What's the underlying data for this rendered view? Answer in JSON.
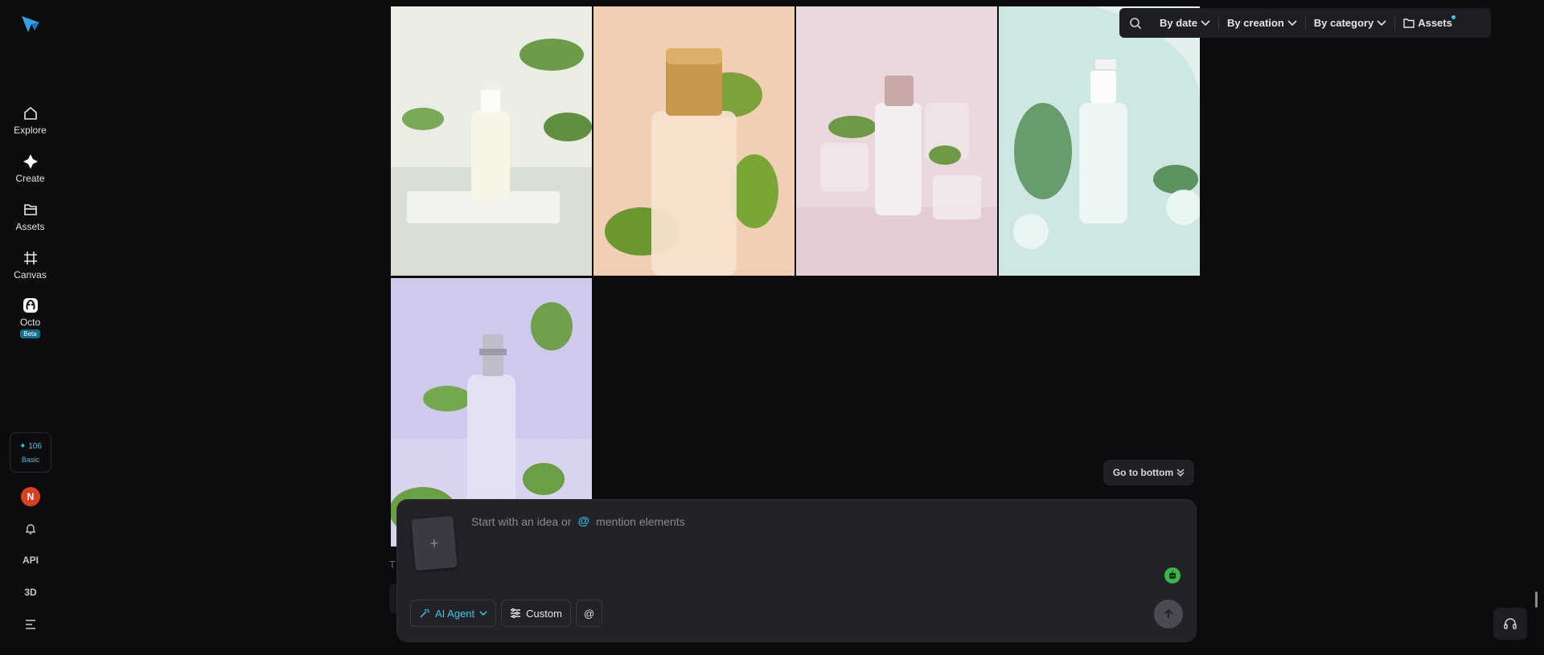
{
  "sidebar": {
    "items": [
      {
        "label": "Explore",
        "icon": "home-icon"
      },
      {
        "label": "Create",
        "icon": "sparkle-icon"
      },
      {
        "label": "Assets",
        "icon": "folder-icon"
      },
      {
        "label": "Canvas",
        "icon": "canvas-icon"
      },
      {
        "label": "Octo",
        "icon": "octo-icon",
        "badge": "Beta"
      }
    ],
    "credits": {
      "value": "106",
      "plan": "Basic"
    },
    "avatar_initial": "N",
    "api_label": "API",
    "three_d_label": "3D"
  },
  "filterbar": {
    "by_date": "By date",
    "by_creation": "By creation",
    "by_category": "By category",
    "assets": "Assets"
  },
  "gallery": {
    "images": [
      {
        "name": "serum pump bottle on acrylic with leaves",
        "bg": "#e8ece2"
      },
      {
        "name": "gold cap perfume bottle with leaves",
        "bg": "#f0cfb3"
      },
      {
        "name": "frosted bottle with ice cubes on pink",
        "bg": "#ead8dd"
      },
      {
        "name": "pump bottle with eucalyptus on mint",
        "bg": "#cfe7e2"
      },
      {
        "name": "spray bottle with leaves on lavender",
        "bg": "#cfc9ee"
      }
    ]
  },
  "go_to_bottom": "Go to bottom",
  "composer": {
    "placeholder_start": "Start with an idea or",
    "placeholder_at": "@",
    "placeholder_end": "mention elements",
    "agent_label": "AI Agent",
    "custom_label": "Custom",
    "at_label": "@"
  },
  "under_text": "T",
  "colors": {
    "accent": "#3cc8e8",
    "avatar": "#d9411e",
    "background": "#0c0c0e"
  }
}
